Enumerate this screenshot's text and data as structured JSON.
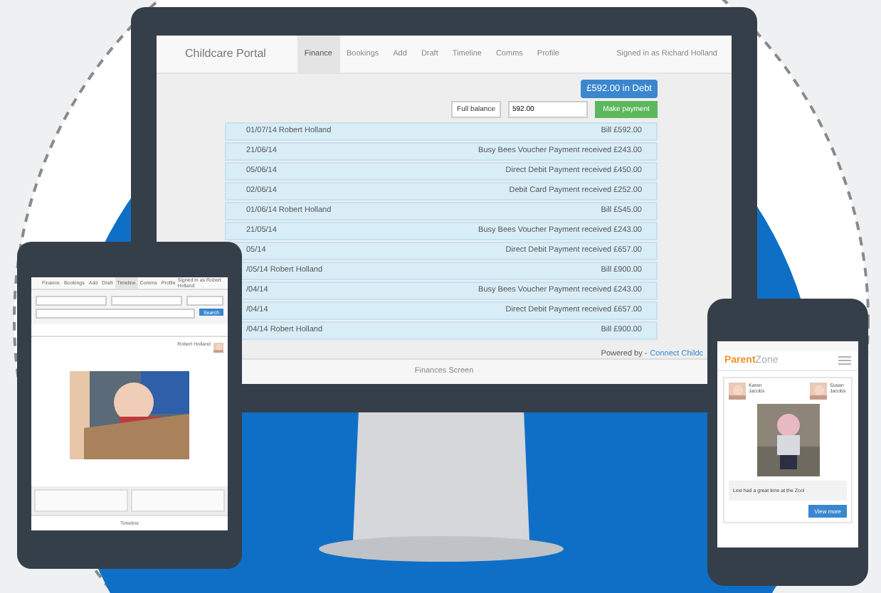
{
  "monitor": {
    "brand": "Childcare Portal",
    "tabs": [
      {
        "label": "Finance",
        "selected": true
      },
      {
        "label": "Bookings",
        "selected": false
      },
      {
        "label": "Add",
        "selected": false
      },
      {
        "label": "Draft",
        "selected": false
      },
      {
        "label": "Timeline",
        "selected": false
      },
      {
        "label": "Comms",
        "selected": false
      },
      {
        "label": "Profile",
        "selected": false
      }
    ],
    "user": "Signed in as Richard Holland",
    "debt_badge": "£592.00 in Debt",
    "balance_button": "Full balance",
    "amount": {
      "value": "592.00"
    },
    "pay_button": "Make payment",
    "transactions": [
      {
        "date": "01/07/14 Robert Holland",
        "detail": "Bill £592.00"
      },
      {
        "date": "21/06/14",
        "detail": "Busy Bees Voucher Payment received £243.00"
      },
      {
        "date": "05/06/14",
        "detail": "Direct Debit Payment received £450.00"
      },
      {
        "date": "02/06/14",
        "detail": "Debit Card Payment received £252.00"
      },
      {
        "date": "01/06/14 Robert Holland",
        "detail": "Bill £545.00"
      },
      {
        "date": "21/05/14",
        "detail": "Busy Bees Voucher Payment received £243.00"
      },
      {
        "date": "05/14",
        "detail": "Direct Debit Payment received £657.00"
      },
      {
        "date": "/05/14 Robert Holland",
        "detail": "Bill £900.00"
      },
      {
        "date": "/04/14",
        "detail": "Busy Bees Voucher Payment received £243.00"
      },
      {
        "date": "/04/14",
        "detail": "Direct Debit Payment received £657.00"
      },
      {
        "date": "/04/14 Robert Holland",
        "detail": "Bill £900.00"
      }
    ],
    "powered_by": "Powered by -",
    "powered_link": "Connect Childc",
    "footer": "Finances Screen"
  },
  "tablet": {
    "tabs": [
      {
        "label": "Finance",
        "selected": false
      },
      {
        "label": "Bookings",
        "selected": false
      },
      {
        "label": "Add",
        "selected": false
      },
      {
        "label": "Draft",
        "selected": false
      },
      {
        "label": "Timeline",
        "selected": true
      },
      {
        "label": "Comms",
        "selected": false
      },
      {
        "label": "Profile",
        "selected": false
      }
    ],
    "user": "Signed in as Robert Holland",
    "search_button": "Search",
    "author": "Robert Holland",
    "footer": "Timeline"
  },
  "phone": {
    "logo_first": "Parent",
    "logo_second": "Zone",
    "children": [
      {
        "name": "Karen Jacobs"
      },
      {
        "name": "Susan Jacobs"
      }
    ],
    "note": "Lexi had a great time at the Zoo!",
    "button": "View more"
  }
}
